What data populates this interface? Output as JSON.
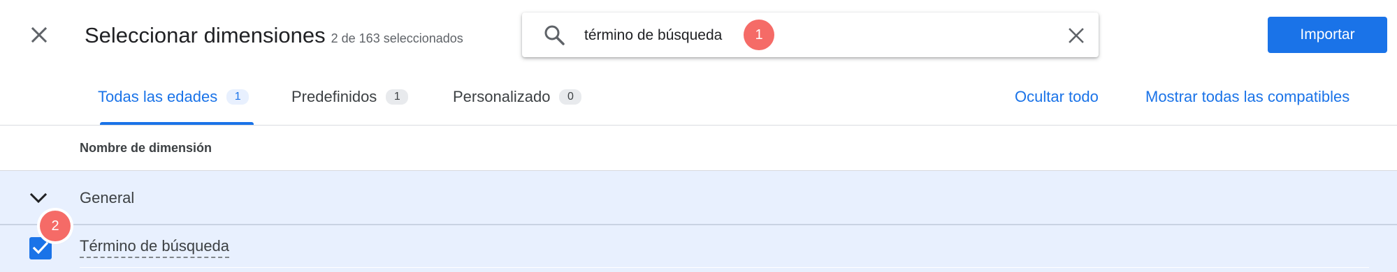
{
  "header": {
    "title": "Seleccionar dimensiones",
    "selected_count": "2 de 163 seleccionados",
    "import_label": "Importar"
  },
  "search": {
    "value": "término de búsqueda",
    "placeholder": ""
  },
  "annotations": {
    "badge_1": "1",
    "badge_2": "2"
  },
  "tabs": [
    {
      "label": "Todas las edades",
      "count": "1",
      "active": true
    },
    {
      "label": "Predefinidos",
      "count": "1",
      "active": false
    },
    {
      "label": "Personalizado",
      "count": "0",
      "active": false
    }
  ],
  "actions": {
    "hide_all": "Ocultar todo",
    "show_all": "Mostrar todas las compatibles"
  },
  "table": {
    "column_header": "Nombre de dimensión",
    "groups": [
      {
        "label": "General",
        "expanded": true,
        "items": [
          {
            "label": "Término de búsqueda",
            "checked": true
          }
        ]
      }
    ]
  },
  "colors": {
    "accent": "#1a73e8",
    "badge": "#f56b67",
    "row_highlight": "#e8f0fe"
  },
  "icons": [
    "close-icon",
    "search-icon",
    "clear-icon",
    "chevron-down-icon",
    "checkmark-icon"
  ]
}
